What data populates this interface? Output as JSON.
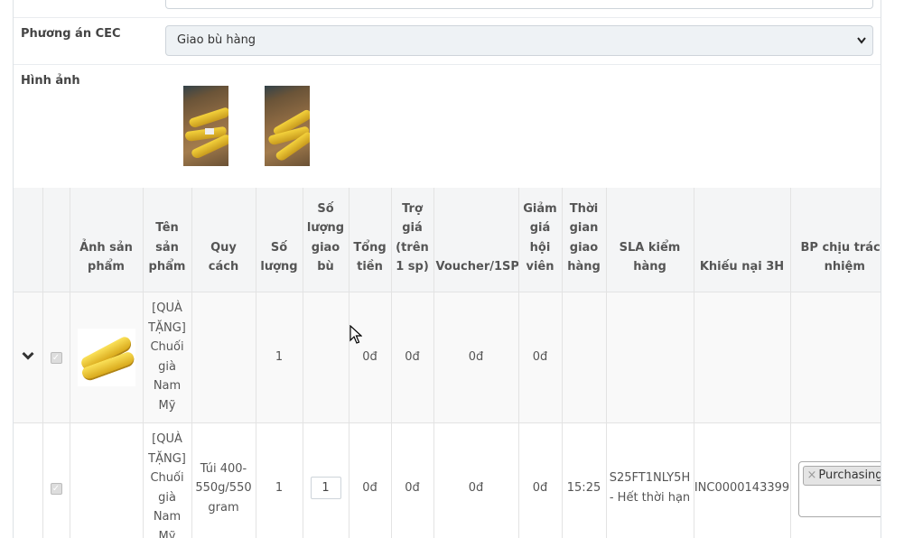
{
  "form": {
    "cec_label": "Phương án CEC",
    "cec_value": "Giao bù hàng",
    "images_label": "Hình ảnh"
  },
  "table": {
    "headers": [
      "",
      "",
      "Ảnh sản phẩm",
      "Tên sản phẩm",
      "Quy cách",
      "Số lượng",
      "Số lượng giao bù",
      "Tổng tiền",
      "Trợ giá (trên 1 sp)",
      "Voucher/1SP",
      "Giảm giá hội viên",
      "Thời gian giao hàng",
      "SLA kiểm hàng",
      "Khiếu nại 3H",
      "BP chịu trách nhiệm"
    ],
    "rows": [
      {
        "name": "[QUÀ TẶNG] Chuối già Nam Mỹ",
        "spec": "",
        "qty": "1",
        "comp_qty": "",
        "total": "0đ",
        "subsidy": "0đ",
        "voucher": "0đ",
        "member_discount": "0đ",
        "delivery_time": "",
        "sla": "",
        "complaint": "",
        "dept": ""
      },
      {
        "name": "[QUÀ TẶNG] Chuối già Nam Mỹ",
        "spec": "Túi 400-550g/550 gram",
        "qty": "1",
        "comp_qty": "1",
        "total": "0đ",
        "subsidy": "0đ",
        "voucher": "0đ",
        "member_discount": "0đ",
        "delivery_time": "15:25",
        "sla": "S25FT1NLY5H - Hết thời hạn",
        "complaint": "INC0000143399",
        "dept": "Purchasing"
      }
    ]
  },
  "icons": {
    "expand": "chevron-down-icon",
    "remove_tag": "×",
    "check": "✓"
  }
}
